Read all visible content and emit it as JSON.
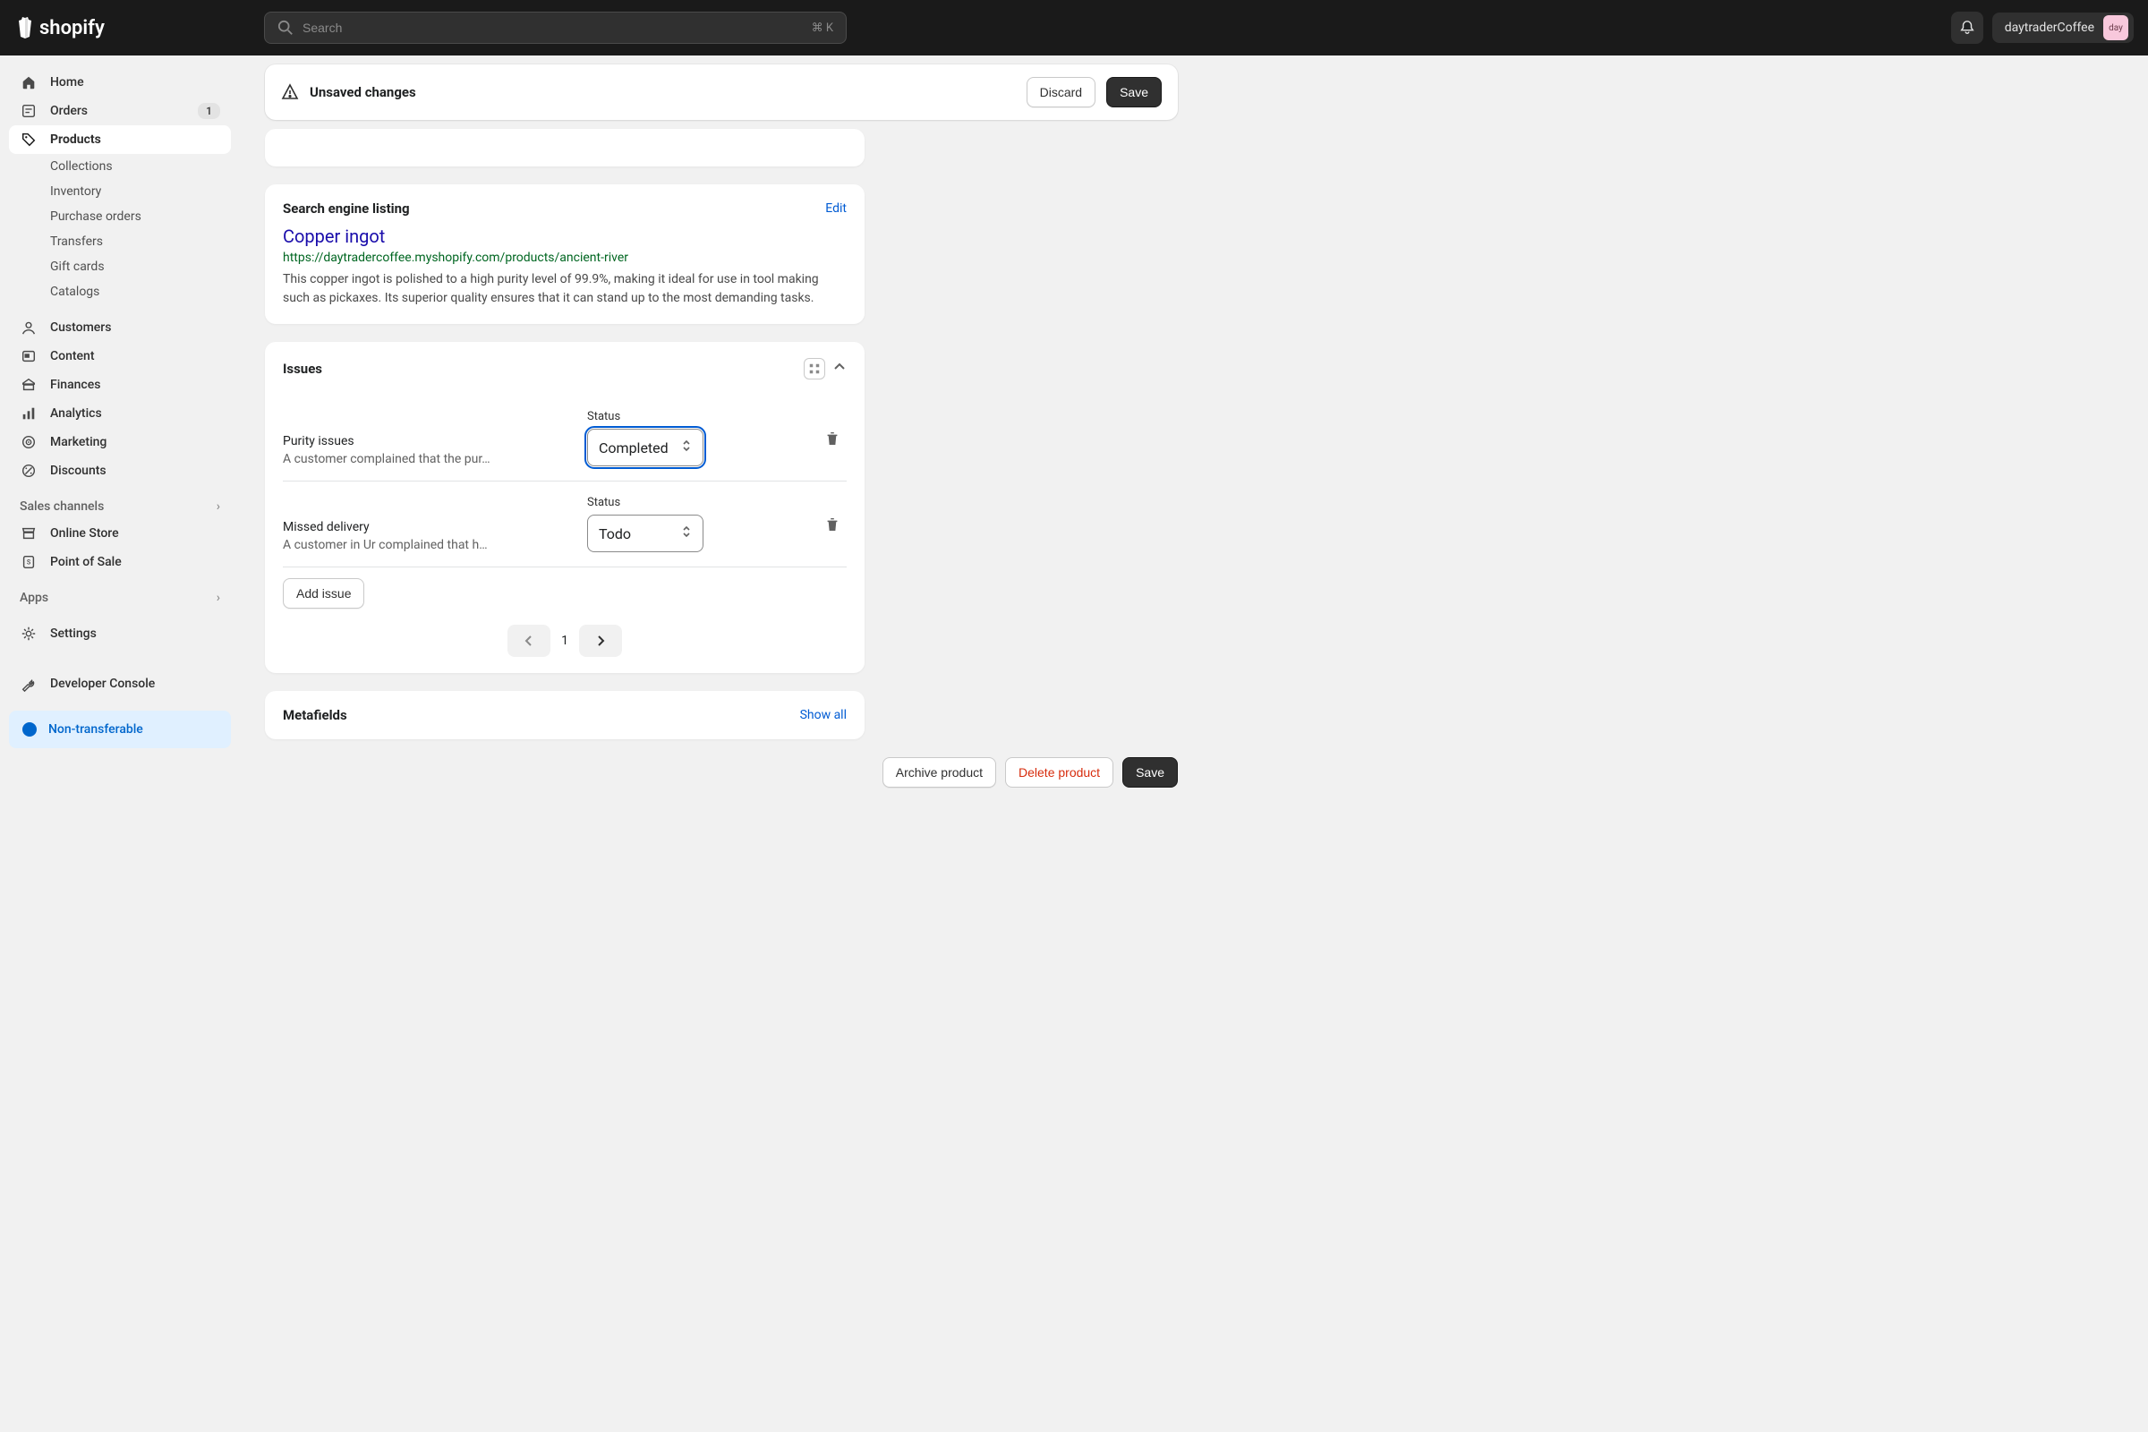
{
  "topbar": {
    "brand": "shopify",
    "search_placeholder": "Search",
    "shortcut": "⌘ K",
    "store_name": "daytraderCoffee",
    "avatar_abbr": "day"
  },
  "unsaved_bar": {
    "title": "Unsaved changes",
    "discard": "Discard",
    "save": "Save"
  },
  "sidebar": {
    "home": "Home",
    "orders": "Orders",
    "orders_badge": "1",
    "products": "Products",
    "subs": {
      "collections": "Collections",
      "inventory": "Inventory",
      "purchase_orders": "Purchase orders",
      "transfers": "Transfers",
      "gift_cards": "Gift cards",
      "catalogs": "Catalogs"
    },
    "customers": "Customers",
    "content": "Content",
    "finances": "Finances",
    "analytics": "Analytics",
    "marketing": "Marketing",
    "discounts": "Discounts",
    "sales_channels": "Sales channels",
    "online_store": "Online Store",
    "point_of_sale": "Point of Sale",
    "apps": "Apps",
    "settings": "Settings",
    "developer_console": "Developer Console",
    "non_transferable": "Non-transferable"
  },
  "seo": {
    "section_title": "Search engine listing",
    "edit": "Edit",
    "title": "Copper ingot",
    "url": "https://daytradercoffee.myshopify.com/products/ancient-river",
    "description": "This copper ingot is polished to a high purity level of 99.9%, making it ideal for use in tool making such as pickaxes. Its superior quality ensures that it can stand up to the most demanding tasks."
  },
  "issues": {
    "section_title": "Issues",
    "status_label": "Status",
    "items": [
      {
        "title": "Purity issues",
        "desc": "A customer complained that the pur…",
        "status": "Completed"
      },
      {
        "title": "Missed delivery",
        "desc": "A customer in Ur complained that h…",
        "status": "Todo"
      }
    ],
    "add_button": "Add issue",
    "page": "1"
  },
  "metafields": {
    "title": "Metafields",
    "show_all": "Show all"
  },
  "footer": {
    "archive": "Archive product",
    "delete": "Delete product",
    "save": "Save"
  }
}
